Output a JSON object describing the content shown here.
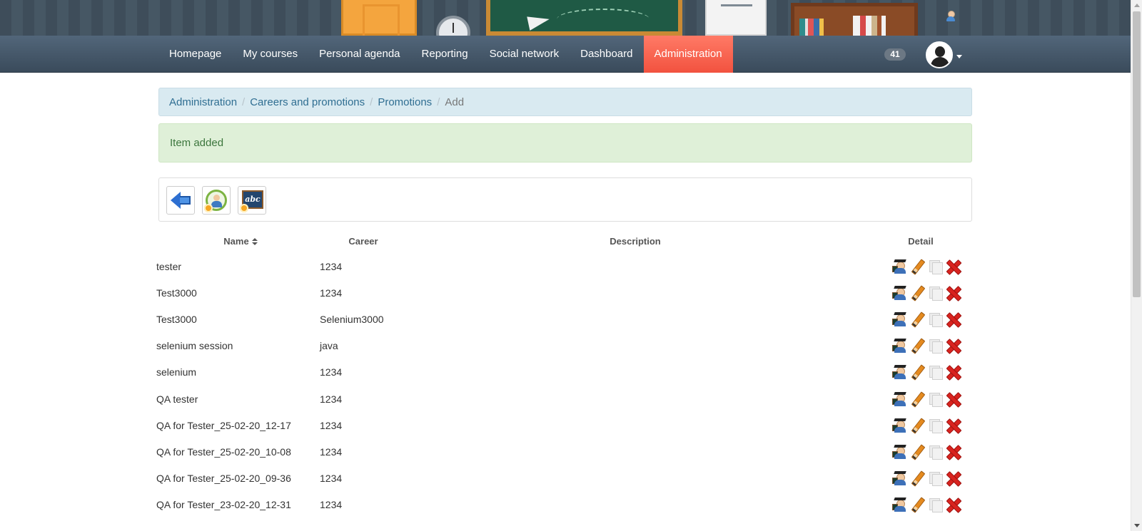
{
  "nav": {
    "items": [
      {
        "label": "Homepage",
        "active": false
      },
      {
        "label": "My courses",
        "active": false
      },
      {
        "label": "Personal agenda",
        "active": false
      },
      {
        "label": "Reporting",
        "active": false
      },
      {
        "label": "Social network",
        "active": false
      },
      {
        "label": "Dashboard",
        "active": false
      },
      {
        "label": "Administration",
        "active": true
      }
    ],
    "notification_count": "41",
    "avatar_icon": "user-silhouette-icon",
    "active_color": "#f2523f"
  },
  "breadcrumb": {
    "items": [
      "Administration",
      "Careers and promotions",
      "Promotions"
    ],
    "current": "Add"
  },
  "alert": {
    "message": "Item added",
    "color": "#dff0d8"
  },
  "toolbar": {
    "buttons": [
      "back-arrow-icon",
      "teacher-wreath-icon",
      "abc-board-icon"
    ],
    "abc_text": "abc"
  },
  "table": {
    "headers": {
      "name": "Name",
      "career": "Career",
      "description": "Description",
      "detail": "Detail"
    },
    "sort_column": "name",
    "rows": [
      {
        "name": "tester",
        "career": "1234",
        "description": ""
      },
      {
        "name": "Test3000",
        "career": "1234",
        "description": ""
      },
      {
        "name": "Test3000",
        "career": "Selenium3000",
        "description": ""
      },
      {
        "name": "selenium session",
        "career": "java",
        "description": ""
      },
      {
        "name": "selenium",
        "career": "1234",
        "description": ""
      },
      {
        "name": "QA tester",
        "career": "1234",
        "description": ""
      },
      {
        "name": "QA for Tester_25-02-20_12-17",
        "career": "1234",
        "description": ""
      },
      {
        "name": "QA for Tester_25-02-20_10-08",
        "career": "1234",
        "description": ""
      },
      {
        "name": "QA for Tester_25-02-20_09-36",
        "career": "1234",
        "description": ""
      },
      {
        "name": "QA for Tester_23-02-20_12-31",
        "career": "1234",
        "description": ""
      }
    ],
    "row_actions": [
      "subscribe-sessions-icon",
      "edit-pencil-icon",
      "copy-icon",
      "delete-icon"
    ]
  }
}
